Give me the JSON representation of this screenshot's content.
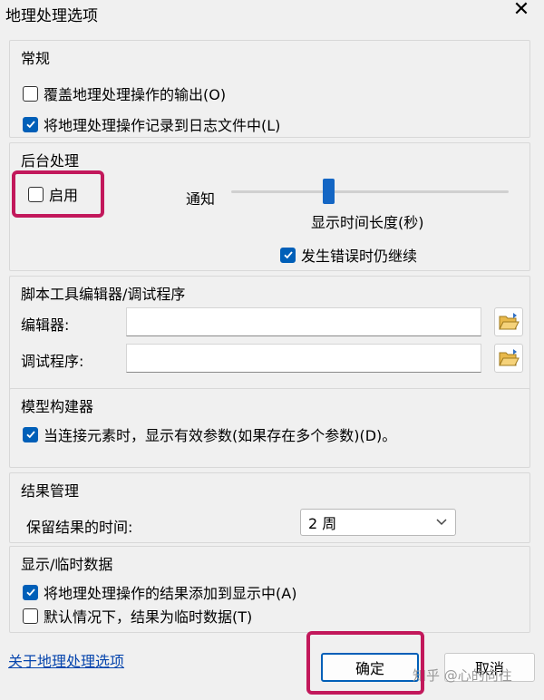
{
  "window": {
    "title": "地理处理选项",
    "close_symbol": "✕"
  },
  "general": {
    "title": "常规",
    "overwrite_output": {
      "label": "覆盖地理处理操作的输出(O)",
      "checked": false
    },
    "log_to_file": {
      "label": "将地理处理操作记录到日志文件中(L)",
      "checked": true
    }
  },
  "background": {
    "title": "后台处理",
    "enable": {
      "label": "启用",
      "checked": false
    },
    "notify_label": "通知",
    "duration_label": "显示时间长度(秒)",
    "duration_slider_fraction": 0.35,
    "continue_on_error": {
      "label": "发生错误时仍继续",
      "checked": true
    }
  },
  "script_tools": {
    "title": "脚本工具编辑器/调试程序",
    "editor_label": "编辑器:",
    "editor_value": "",
    "debugger_label": "调试程序:",
    "debugger_value": ""
  },
  "model_builder": {
    "title": "模型构建器",
    "show_valid_params": {
      "label": "当连接元素时，显示有效参数(如果存在多个参数)(D)。",
      "checked": true
    }
  },
  "results": {
    "title": "结果管理",
    "keep_label": "保留结果的时间:",
    "keep_value": "2 周"
  },
  "display_temp": {
    "title": "显示/临时数据",
    "add_to_display": {
      "label": "将地理处理操作的结果添加到显示中(A)",
      "checked": true
    },
    "temporary_default": {
      "label": "默认情况下，结果为临时数据(T)",
      "checked": false
    }
  },
  "footer": {
    "about_link": "关于地理处理选项",
    "ok_label": "确定",
    "cancel_label": "取消",
    "watermark": "知乎 @心的向往"
  },
  "colors": {
    "accent": "#005fb8",
    "highlight": "#c2185b",
    "link": "#0645ad"
  }
}
